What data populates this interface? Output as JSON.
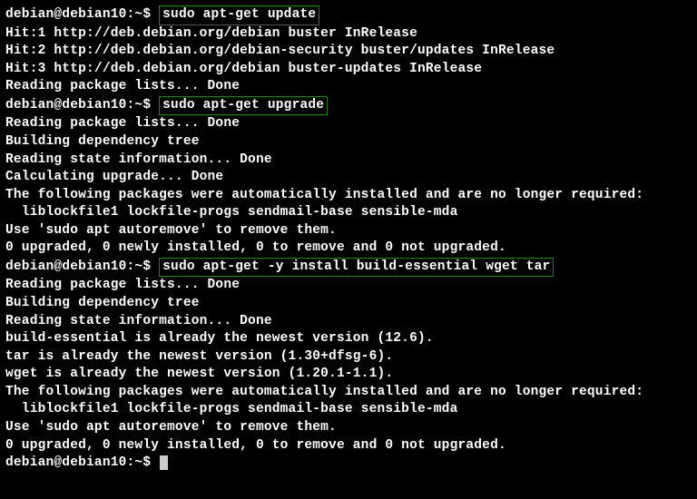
{
  "prompt": "debian@debian10:~$ ",
  "cmd1": "sudo apt-get update",
  "out1": [
    "Hit:1 http://deb.debian.org/debian buster InRelease",
    "Hit:2 http://deb.debian.org/debian-security buster/updates InRelease",
    "Hit:3 http://deb.debian.org/debian buster-updates InRelease",
    "Reading package lists... Done"
  ],
  "cmd2": "sudo apt-get upgrade",
  "out2": [
    "Reading package lists... Done",
    "Building dependency tree",
    "Reading state information... Done",
    "Calculating upgrade... Done",
    "The following packages were automatically installed and are no longer required:",
    "  liblockfile1 lockfile-progs sendmail-base sensible-mda",
    "Use 'sudo apt autoremove' to remove them.",
    "0 upgraded, 0 newly installed, 0 to remove and 0 not upgraded."
  ],
  "cmd3": "sudo apt-get -y install build-essential wget tar",
  "out3": [
    "Reading package lists... Done",
    "Building dependency tree",
    "Reading state information... Done",
    "build-essential is already the newest version (12.6).",
    "tar is already the newest version (1.30+dfsg-6).",
    "wget is already the newest version (1.20.1-1.1).",
    "The following packages were automatically installed and are no longer required:",
    "  liblockfile1 lockfile-progs sendmail-base sensible-mda",
    "Use 'sudo apt autoremove' to remove them.",
    "0 upgraded, 0 newly installed, 0 to remove and 0 not upgraded."
  ]
}
